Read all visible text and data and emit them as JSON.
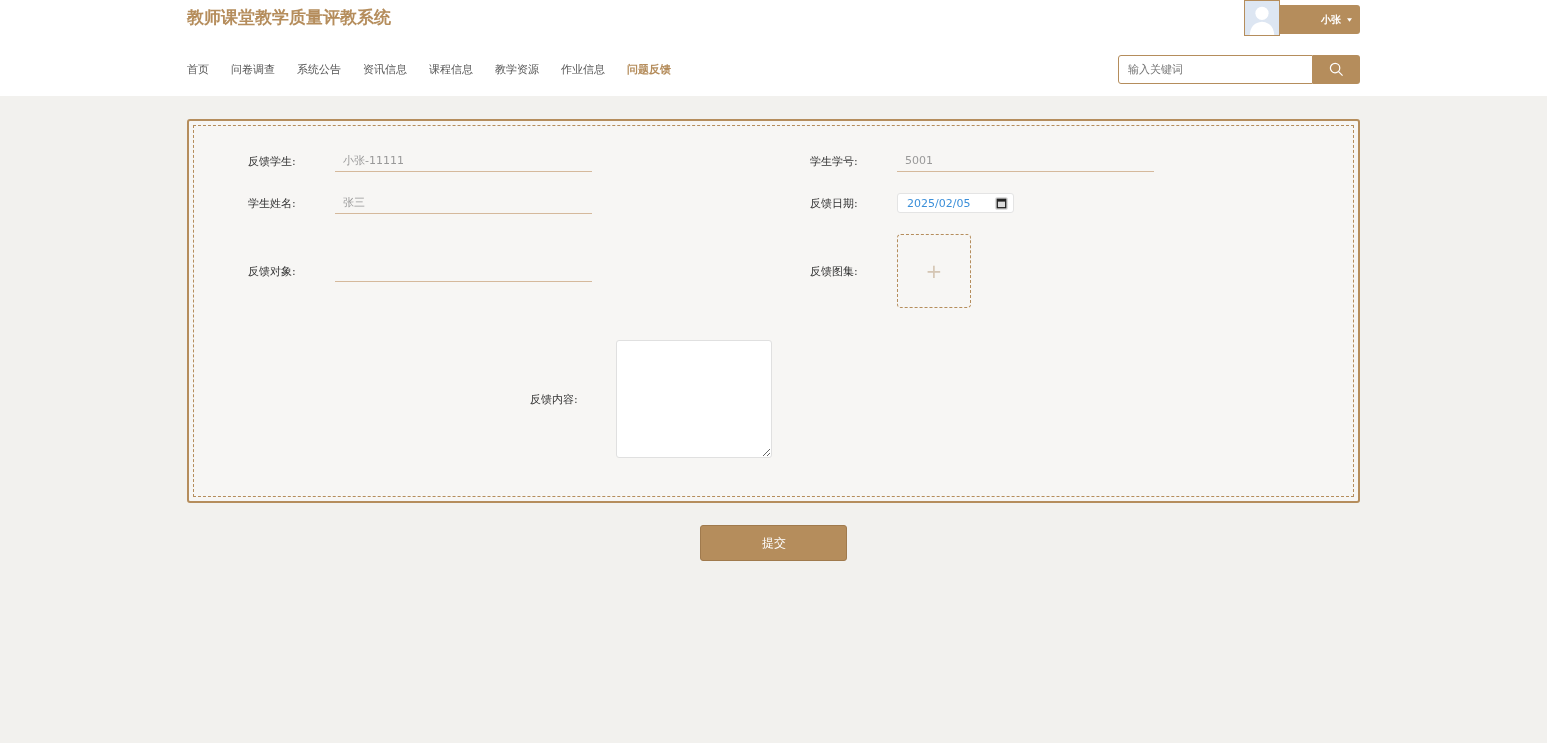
{
  "header": {
    "title": "教师课堂教学质量评教系统",
    "user": {
      "name": "小张"
    },
    "search": {
      "placeholder": "输入关键词"
    }
  },
  "nav": [
    {
      "label": "首页",
      "selected": false
    },
    {
      "label": "问卷调查",
      "selected": false
    },
    {
      "label": "系统公告",
      "selected": false
    },
    {
      "label": "资讯信息",
      "selected": false
    },
    {
      "label": "课程信息",
      "selected": false
    },
    {
      "label": "教学资源",
      "selected": false
    },
    {
      "label": "作业信息",
      "selected": false
    },
    {
      "label": "问题反馈",
      "selected": true
    }
  ],
  "form": {
    "fields": [
      {
        "kind": "text",
        "label": "反馈学生:",
        "value": "小张-11111"
      },
      {
        "kind": "text",
        "label": "学生学号:",
        "value": "5001"
      },
      {
        "kind": "text",
        "label": "学生姓名:",
        "value": "张三"
      },
      {
        "kind": "date",
        "label": "反馈日期:",
        "value": "2025/02/05"
      },
      {
        "kind": "text",
        "label": "反馈对象:"
      },
      {
        "kind": "upload",
        "label": "反馈图集:",
        "icon": "+"
      }
    ],
    "content_label": "反馈内容:",
    "submit": "提交"
  }
}
